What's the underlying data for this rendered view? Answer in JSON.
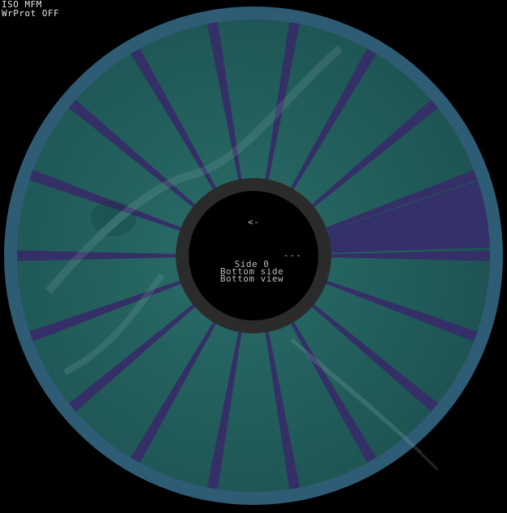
{
  "status": {
    "format": "ISO MFM",
    "write_protect": "WrProt OFF"
  },
  "hub": {
    "arrow": "<-",
    "dashes": "---",
    "side": "Side 0",
    "surface": "Bottom side",
    "view": "Bottom view"
  },
  "colors": {
    "background": "#000000",
    "rim": "#2e5c74",
    "track_area": "#1f5a57",
    "sector_gap": "#342f66",
    "highlighted_sector": "#34306a",
    "hub_ring": "#2b2b2b",
    "hub_center": "#000000",
    "text": "#e6e6e6"
  },
  "disk": {
    "sector_count": 18,
    "highlighted_sector_index": 0
  }
}
